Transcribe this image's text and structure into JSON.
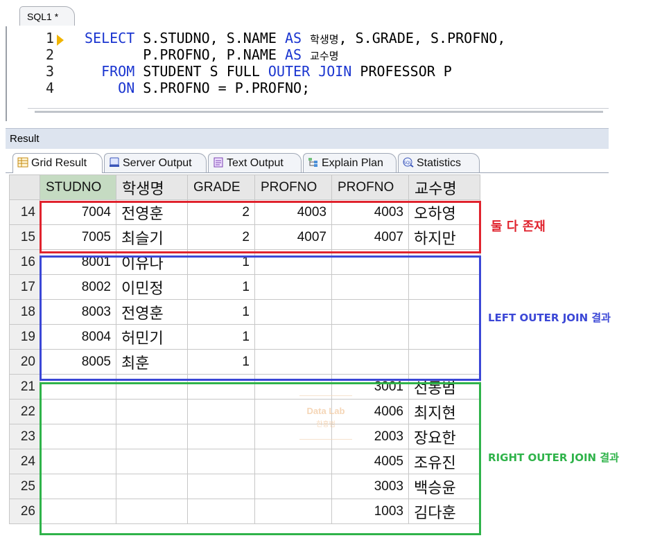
{
  "editor": {
    "tab_label": "SQL1 *",
    "line_numbers": [
      "1",
      "2",
      "3",
      "4"
    ]
  },
  "result_panel": {
    "title": "Result",
    "tabs": [
      "Grid Result",
      "Server Output",
      "Text Output",
      "Explain Plan",
      "Statistics"
    ],
    "active_tab": "Grid Result"
  },
  "grid": {
    "columns": [
      "STUDNO",
      "학생명",
      "GRADE",
      "PROFNO",
      "PROFNO",
      "교수명"
    ],
    "rows": [
      {
        "row": "14",
        "studno": "7004",
        "name": "전영훈",
        "grade": "2",
        "profno_s": "4003",
        "profno_p": "4003",
        "prof": "오하영"
      },
      {
        "row": "15",
        "studno": "7005",
        "name": "최슬기",
        "grade": "2",
        "profno_s": "4007",
        "profno_p": "4007",
        "prof": "하지만"
      },
      {
        "row": "16",
        "studno": "8001",
        "name": "이유나",
        "grade": "1",
        "profno_s": "",
        "profno_p": "",
        "prof": ""
      },
      {
        "row": "17",
        "studno": "8002",
        "name": "이민정",
        "grade": "1",
        "profno_s": "",
        "profno_p": "",
        "prof": ""
      },
      {
        "row": "18",
        "studno": "8003",
        "name": "전영훈",
        "grade": "1",
        "profno_s": "",
        "profno_p": "",
        "prof": ""
      },
      {
        "row": "19",
        "studno": "8004",
        "name": "허민기",
        "grade": "1",
        "profno_s": "",
        "profno_p": "",
        "prof": ""
      },
      {
        "row": "20",
        "studno": "8005",
        "name": "최훈",
        "grade": "1",
        "profno_s": "",
        "profno_p": "",
        "prof": ""
      },
      {
        "row": "21",
        "studno": "",
        "name": "",
        "grade": "",
        "profno_s": "",
        "profno_p": "3001",
        "prof": "선동범"
      },
      {
        "row": "22",
        "studno": "",
        "name": "",
        "grade": "",
        "profno_s": "",
        "profno_p": "4006",
        "prof": "최지현"
      },
      {
        "row": "23",
        "studno": "",
        "name": "",
        "grade": "",
        "profno_s": "",
        "profno_p": "2003",
        "prof": "장요한"
      },
      {
        "row": "24",
        "studno": "",
        "name": "",
        "grade": "",
        "profno_s": "",
        "profno_p": "4005",
        "prof": "조유진"
      },
      {
        "row": "25",
        "studno": "",
        "name": "",
        "grade": "",
        "profno_s": "",
        "profno_p": "3003",
        "prof": "백승윤"
      },
      {
        "row": "26",
        "studno": "",
        "name": "",
        "grade": "",
        "profno_s": "",
        "profno_p": "1003",
        "prof": "김다훈"
      }
    ]
  },
  "annotations": {
    "both": "둘 다 존재",
    "left": "LEFT OUTER JOIN 결과",
    "right": "RIGHT OUTER JOIN 결과"
  },
  "watermark": {
    "line1": "Data Lab",
    "line2": "한홍범"
  },
  "colors": {
    "keyword": "#1a35d0",
    "both_box": "#e0232e",
    "left_box": "#3b47d6",
    "right_box": "#2fb34a",
    "selected_header": "#c5dbc2"
  },
  "icons": [
    "run-arrow-icon",
    "grid-result-icon",
    "server-output-icon",
    "text-output-icon",
    "explain-plan-icon",
    "statistics-icon"
  ]
}
